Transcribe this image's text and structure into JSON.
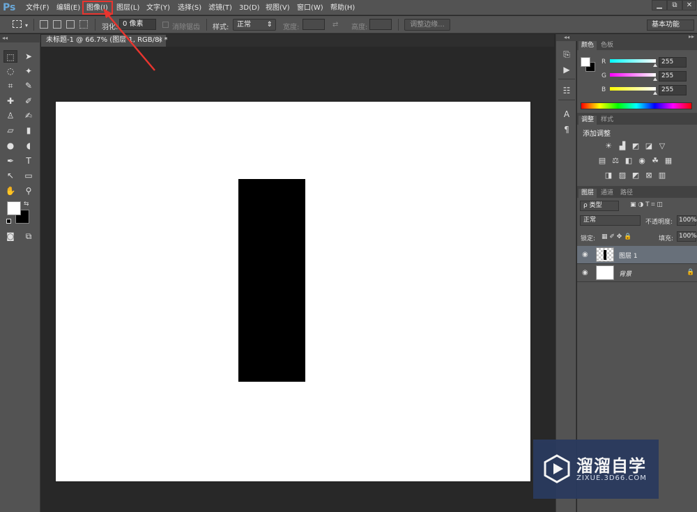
{
  "app": {
    "logo": "Ps"
  },
  "menu": {
    "items": [
      "文件(F)",
      "编辑(E)",
      "图像(I)",
      "图层(L)",
      "文字(Y)",
      "选择(S)",
      "滤镜(T)",
      "3D(D)",
      "视图(V)",
      "窗口(W)",
      "帮助(H)"
    ],
    "highlighted_index": 2,
    "annotation_color": "#e8352f"
  },
  "window_controls": {
    "minimize": "▁",
    "restore": "⧉",
    "close": "✕"
  },
  "options_bar": {
    "feather_label": "羽化:",
    "feather_value": "0 像素",
    "antialias_label": "消除锯齿",
    "style_label": "样式:",
    "style_value": "正常",
    "width_label": "宽度:",
    "height_label": "高度:",
    "refine_edge": "调整边缘...",
    "workspace": "基本功能"
  },
  "document": {
    "tab_title": "未标题-1 @ 66.7% (图层 1, RGB/8) *",
    "close": "×",
    "background_color": "#ffffff",
    "shape_color": "#000000"
  },
  "tools": {
    "collapse": "◂◂",
    "icons": [
      "rect-marquee-icon",
      "move-icon",
      "lasso-icon",
      "magic-wand-icon",
      "crop-icon",
      "eyedropper-icon",
      "healing-brush-icon",
      "brush-icon",
      "clone-stamp-icon",
      "history-brush-icon",
      "eraser-icon",
      "gradient-icon",
      "blur-icon",
      "dodge-icon",
      "pen-icon",
      "type-icon",
      "path-select-icon",
      "rectangle-icon",
      "hand-icon",
      "zoom-icon"
    ],
    "foreground": "#ffffff",
    "background": "#000000"
  },
  "color_panel": {
    "tabs": [
      "颜色",
      "色板"
    ],
    "channels": [
      {
        "label": "R",
        "value": "255"
      },
      {
        "label": "G",
        "value": "255"
      },
      {
        "label": "B",
        "value": "255"
      }
    ]
  },
  "adjustments_panel": {
    "tabs": [
      "调整",
      "样式"
    ],
    "title": "添加调整"
  },
  "layers_panel": {
    "tabs": [
      "图层",
      "通道",
      "路径"
    ],
    "filter": "ρ 类型",
    "blend_mode": "正常",
    "opacity_label": "不透明度:",
    "opacity_value": "100%",
    "lock_label": "锁定:",
    "fill_label": "填充:",
    "fill_value": "100%",
    "layers": [
      {
        "name": "图层 1",
        "selected": true
      },
      {
        "name": "背景",
        "selected": false
      }
    ]
  },
  "watermark": {
    "title": "溜溜自学",
    "url": "ZIXUE.3D66.COM"
  }
}
